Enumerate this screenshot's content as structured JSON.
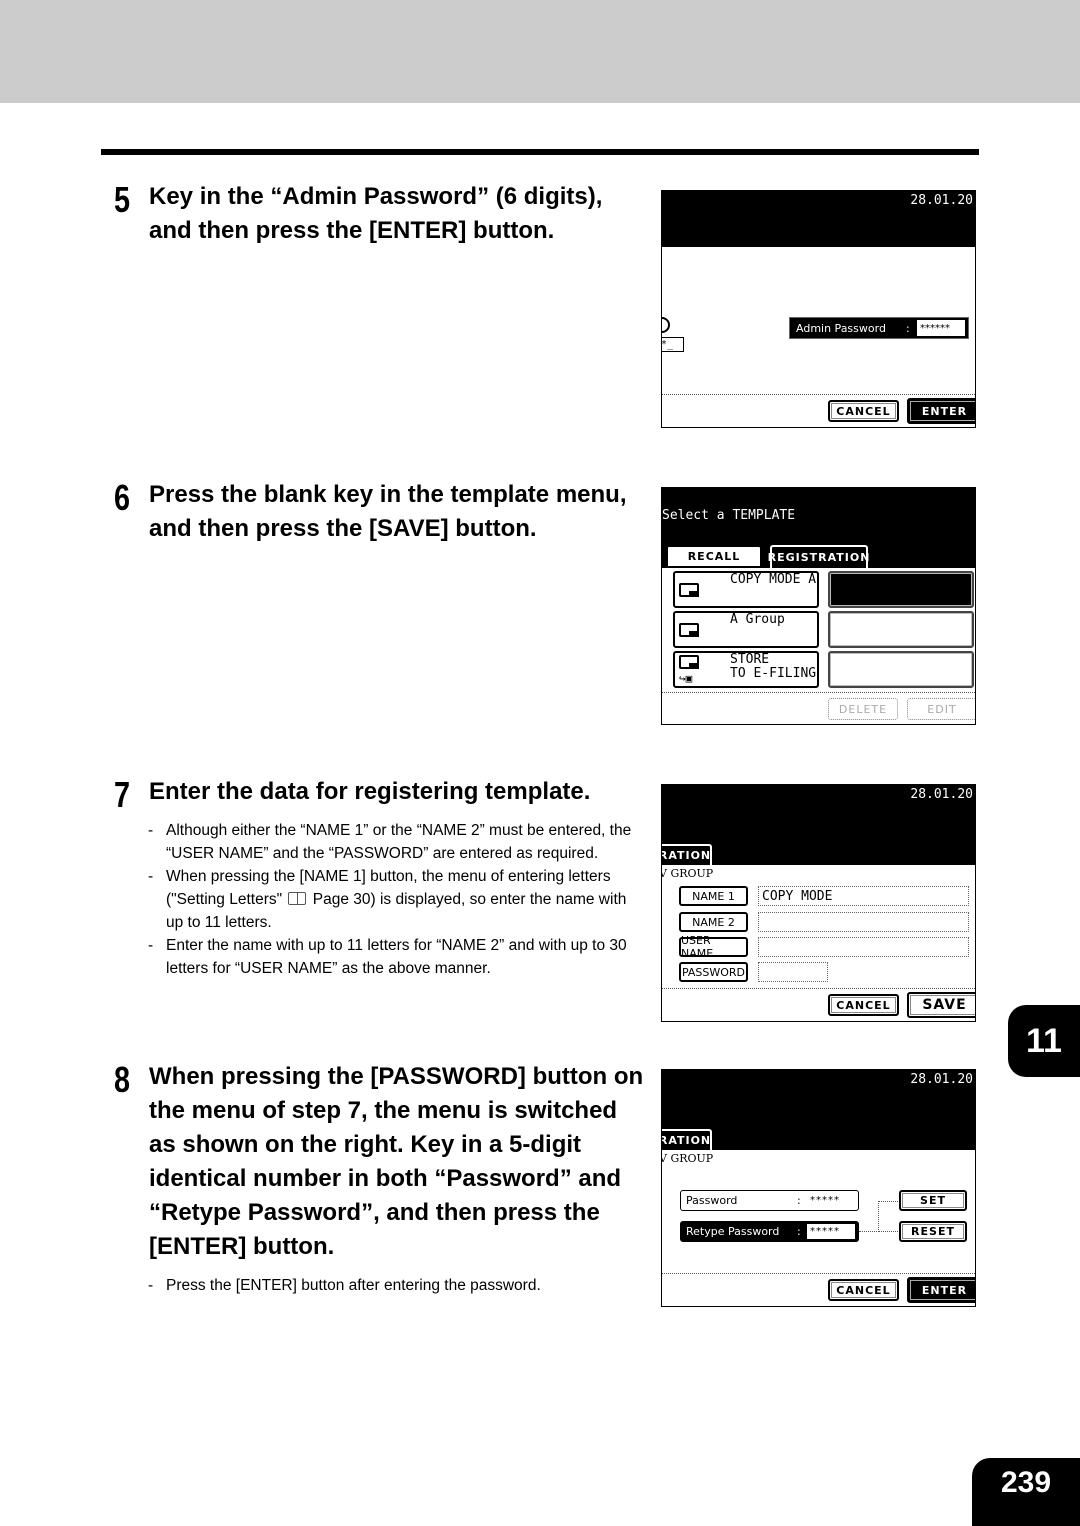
{
  "page": {
    "chapter": "11",
    "page_number": "239"
  },
  "steps": [
    {
      "number": "5",
      "title": "Key in the “Admin Password” (6 digits), and then press the [ENTER] button.",
      "notes": []
    },
    {
      "number": "6",
      "title": "Press the blank key in the template menu, and then press the [SAVE] button.",
      "notes": []
    },
    {
      "number": "7",
      "title": "Enter the data for registering template.",
      "notes": [
        "Although either the “NAME 1” or the “NAME 2” must be entered, the “USER NAME” and the “PASSWORD” are entered as required.",
        "When pressing the [NAME 1] button, the menu of entering letters (\"Setting Letters\"",
        "Enter the name with up to 11 letters for “NAME 2” and with up to 30 letters for “USER NAME” as the above manner."
      ],
      "note2_suffix": "Page 30) is displayed, so enter the name with up to 11 letters."
    },
    {
      "number": "8",
      "title": "When pressing the [PASSWORD] button on the menu of step 7, the menu is switched as shown on the right. Key in a 5-digit identical number in both “Password” and “Retype Password”, and then press the [ENTER] button.",
      "notes": [
        "Press the [ENTER] button after entering the password."
      ]
    }
  ],
  "screens": {
    "admin": {
      "date": "28.01.20",
      "field_label": "Admin Password",
      "field_sep": ":",
      "field_value": "******",
      "key_hint": "*_",
      "cancel": "CANCEL",
      "enter": "ENTER"
    },
    "template": {
      "title": "Select a TEMPLATE",
      "tabs": [
        "RECALL",
        "REGISTRATION"
      ],
      "items": [
        {
          "label": "COPY MODE A"
        },
        {
          "label": "A Group"
        },
        {
          "label": "STORE\nTO E-FILING"
        }
      ],
      "delete": "DELETE",
      "edit": "EDIT"
    },
    "register": {
      "date": "28.01.20",
      "tab": "RATION",
      "group": "V GROUP",
      "fields": [
        {
          "label": "NAME 1",
          "value": "COPY MODE"
        },
        {
          "label": "NAME 2",
          "value": ""
        },
        {
          "label": "USER NAME",
          "value": ""
        },
        {
          "label": "PASSWORD",
          "value": ""
        }
      ],
      "cancel": "CANCEL",
      "save": "SAVE"
    },
    "password": {
      "date": "28.01.20",
      "tab": "RATION",
      "group": "V GROUP",
      "password_label": "Password",
      "password_value": "*****",
      "retype_label": "Retype Password",
      "retype_value": "*****",
      "sep": ":",
      "set": "SET",
      "reset": "RESET",
      "cancel": "CANCEL",
      "enter": "ENTER"
    }
  }
}
